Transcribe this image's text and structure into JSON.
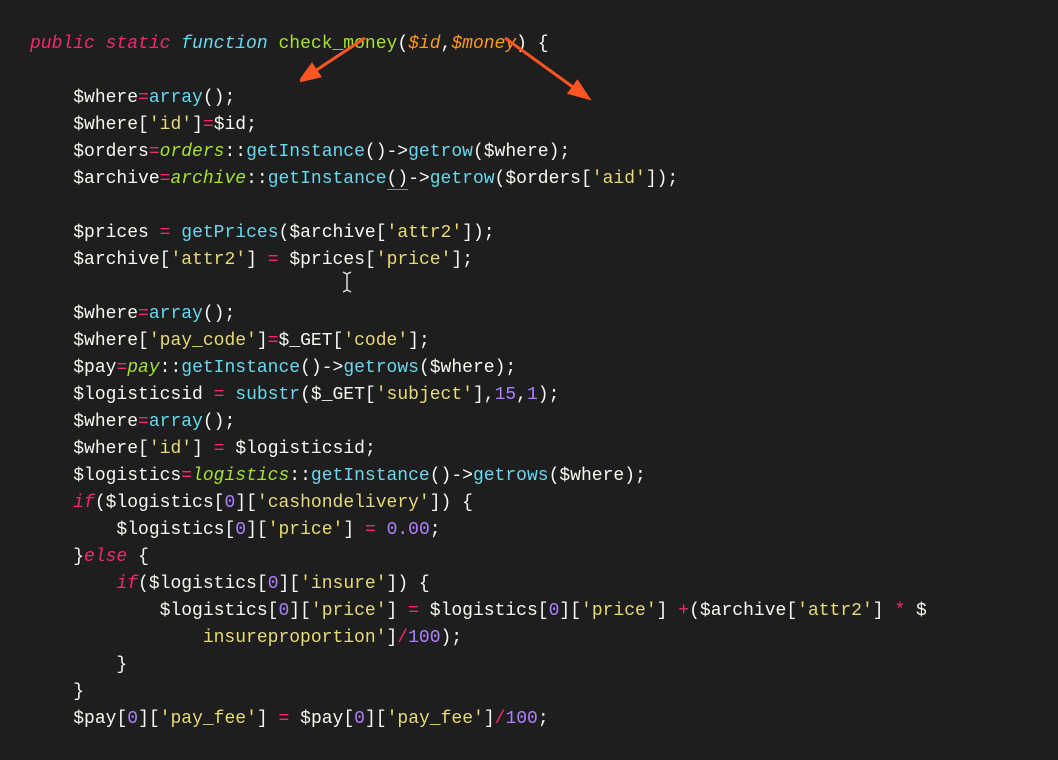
{
  "code": {
    "line1": {
      "public": "public",
      "static": "static",
      "function": "function",
      "name": "check_money",
      "param1": "$id",
      "param2": "$money"
    },
    "l_where1": "$where",
    "l_array": "array",
    "l_id": "'id'",
    "l_idvar": "$id",
    "l_orders": "$orders",
    "l_ordersClass": "orders",
    "l_getInstance": "getInstance",
    "l_getrow": "getrow",
    "l_archive": "$archive",
    "l_archiveClass": "archive",
    "l_aid": "'aid'",
    "l_prices": "$prices",
    "l_getPrices": "getPrices",
    "l_attr2": "'attr2'",
    "l_price": "'price'",
    "l_paycode": "'pay_code'",
    "l_GET": "$_GET",
    "l_code": "'code'",
    "l_pay": "$pay",
    "l_payClass": "pay",
    "l_getrows": "getrows",
    "l_logisticsid": "$logisticsid",
    "l_substr": "substr",
    "l_subject": "'subject'",
    "l_15": "15",
    "l_1": "1",
    "l_logistics": "$logistics",
    "l_logisticsClass": "logistics",
    "l_if": "if",
    "l_0": "0",
    "l_cashondelivery": "'cashondelivery'",
    "l_000": "0.00",
    "l_else": "else",
    "l_insure": "'insure'",
    "l_insureproportion": "insureproportion'",
    "l_100": "100",
    "l_payfee": "'pay_fee'"
  }
}
